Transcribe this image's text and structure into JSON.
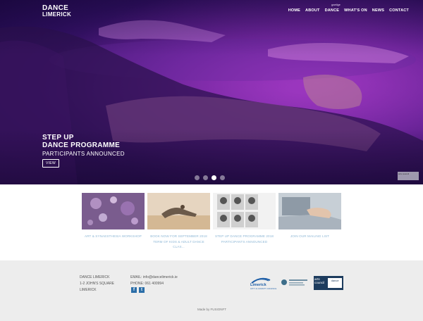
{
  "header": {
    "logo_line1": "DANCE",
    "logo_line2": "LIMERICK",
    "language_link": "gaeilge",
    "nav": [
      "HOME",
      "ABOUT",
      "DANCE",
      "WHAT'S ON",
      "NEWS",
      "CONTACT"
    ]
  },
  "hero": {
    "title_line1": "STEP UP",
    "title_line2": "DANCE PROGRAMME",
    "subtitle": "PARTICIPANTS ANNOUNCED",
    "button_label": "VIEW",
    "slides": {
      "count": 4,
      "active_index": 2
    },
    "badge_text": "arts council"
  },
  "cards": [
    {
      "label_lines": [
        "ART & SYNAESTHESIA WORKSHOP"
      ],
      "icon": "disco-lights-photo"
    },
    {
      "label_lines": [
        "BOOK NOW FOR SEPTEMBER 2018",
        "TERM OF KIDS & ADULT DANCE CLAS..."
      ],
      "icon": "dancer-photo"
    },
    {
      "label_lines": [
        "STEP UP DANCE PROGRAMME 2018",
        "PARTICIPANTS ANNOUNCED"
      ],
      "icon": "portrait-grid-photo"
    },
    {
      "label_lines": [
        "JOIN OUR MAILING LIST"
      ],
      "icon": "laptop-typing-photo"
    }
  ],
  "footer": {
    "address_lines": [
      "DANCE LIMERICK",
      "1-2 JOHN'S SQUARE",
      "LIMERICK"
    ],
    "email": "EMAIL: info@dancelimerick.ie",
    "phone": "PHONE: 061 400994",
    "social": [
      {
        "icon": "facebook-icon",
        "glyph": "f"
      },
      {
        "icon": "twitter-icon",
        "glyph": "t"
      }
    ],
    "sponsor_lcc": "Limerick",
    "sponsor_lcc_sub": "CITY & COUNTY COUNCIL",
    "sponsor_arts_a": "arts council",
    "sponsor_arts_b": "dance",
    "made_by": "Made by FUSIONFT",
    "colors": {
      "footer_bg": "#ededed",
      "link_blue": "#8fb8d6",
      "brand_navy": "#1d3c5e"
    }
  }
}
